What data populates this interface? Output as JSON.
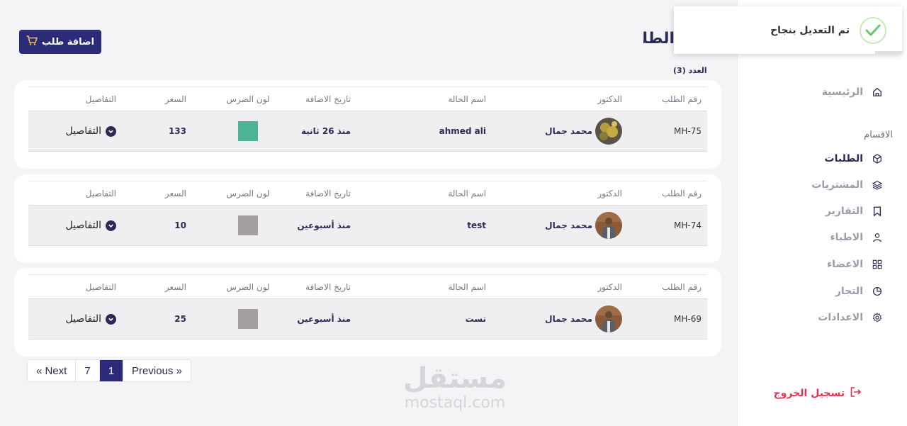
{
  "toast": {
    "message": "تم التعديل بنجاح"
  },
  "header": {
    "title": "الطلبات",
    "add_button_label": "اضافة طلب",
    "count_label": "العدد (3)"
  },
  "sidebar": {
    "home_label": "الرئيسية",
    "section_label": "الاقسام",
    "items": [
      {
        "label": "الطلبات",
        "icon": "cube-icon",
        "active": true
      },
      {
        "label": "المشتريات",
        "icon": "layers-icon",
        "active": false
      },
      {
        "label": "التقارير",
        "icon": "bookmark-icon",
        "active": false
      },
      {
        "label": "الاطباء",
        "icon": "user-icon",
        "active": false
      },
      {
        "label": "الاعضاء",
        "icon": "grid-icon",
        "active": false
      },
      {
        "label": "التجار",
        "icon": "pie-chart-icon",
        "active": false
      },
      {
        "label": "الاعدادات",
        "icon": "gear-icon",
        "active": false
      }
    ],
    "logout_label": "تسجيل الخروج"
  },
  "table": {
    "columns": {
      "order_no": "رقم الطلب",
      "doctor": "الدكتور",
      "case_name": "اسم الحالة",
      "date_added": "تاريخ الاضافة",
      "tooth_color": "لون الضرس",
      "price": "السعر",
      "details": "التفاصيل"
    },
    "orders": [
      {
        "order_no": "MH-75",
        "doctor": "محمد جمال",
        "case_name": "ahmed ali",
        "date_added": "منذ 26 ثانية",
        "tooth_color": "#4cb396",
        "price": "133",
        "details": "التفاصيل"
      },
      {
        "order_no": "MH-74",
        "doctor": "محمد جمال",
        "case_name": "test",
        "date_added": "منذ أسبوعين",
        "tooth_color": "#a39e9e",
        "price": "10",
        "details": "التفاصيل"
      },
      {
        "order_no": "MH-69",
        "doctor": "محمد جمال",
        "case_name": "تست",
        "date_added": "منذ أسبوعين",
        "tooth_color": "#a39e9e",
        "price": "25",
        "details": "التفاصيل"
      }
    ]
  },
  "pagination": {
    "next": "« Next",
    "pages": [
      "7",
      "1"
    ],
    "previous": "Previous »"
  },
  "watermark": {
    "arabic": "مستقل",
    "latin": "mostaql.com"
  },
  "colors": {
    "primary": "#2b2b7a",
    "logout": "#e5314f",
    "success": "#6cc66a"
  }
}
